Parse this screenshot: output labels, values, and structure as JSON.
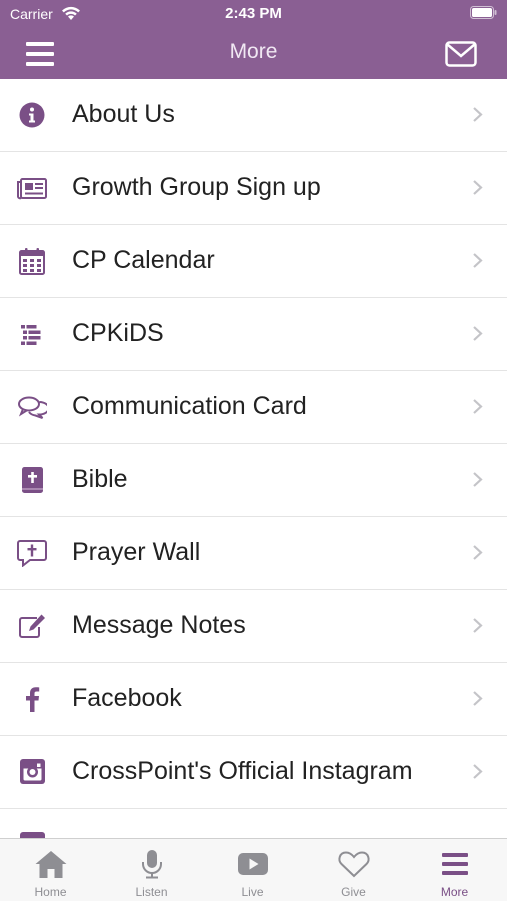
{
  "status": {
    "carrier": "Carrier",
    "time": "2:43 PM"
  },
  "nav": {
    "title": "More"
  },
  "colors": {
    "header": "#8a5f93",
    "icon": "#7a4f86",
    "inactive": "#8e8e93"
  },
  "items": [
    {
      "label": "About Us",
      "icon": "info-icon"
    },
    {
      "label": "Growth Group Sign up",
      "icon": "newspaper-icon"
    },
    {
      "label": "CP Calendar",
      "icon": "calendar-icon"
    },
    {
      "label": "CPKiDS",
      "icon": "list-icon"
    },
    {
      "label": "Communication Card",
      "icon": "comments-icon"
    },
    {
      "label": "Bible",
      "icon": "bible-icon"
    },
    {
      "label": "Prayer Wall",
      "icon": "cross-comment-icon"
    },
    {
      "label": "Message Notes",
      "icon": "edit-icon"
    },
    {
      "label": "Facebook",
      "icon": "facebook-icon"
    },
    {
      "label": "CrossPoint's Official Instagram",
      "icon": "instagram-icon"
    }
  ],
  "tabs": [
    {
      "label": "Home",
      "icon": "home-icon"
    },
    {
      "label": "Listen",
      "icon": "microphone-icon"
    },
    {
      "label": "Live",
      "icon": "play-icon"
    },
    {
      "label": "Give",
      "icon": "heart-icon"
    },
    {
      "label": "More",
      "icon": "menu-icon",
      "active": true
    }
  ]
}
